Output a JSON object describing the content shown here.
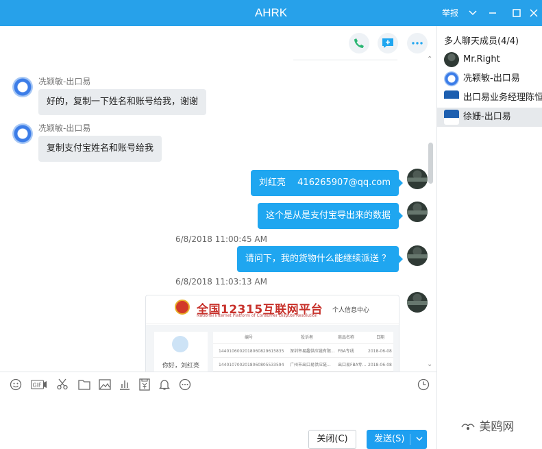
{
  "window": {
    "title": "AHRK",
    "report_label": "举报"
  },
  "chat": {
    "messages_left": [
      {
        "sender": "冼颖敏-出口易",
        "text": "好的，复制一下姓名和账号给我，谢谢"
      },
      {
        "sender": "冼颖敏-出口易",
        "text": "复制支付宝姓名和账号给我"
      }
    ],
    "messages_right": [
      {
        "text": "刘红亮　 416265907@qq.com"
      },
      {
        "text": "这个是从是支付宝导出来的数据"
      },
      {
        "text": "请问下，我的货物什么能继续派送 ？"
      }
    ],
    "timestamps": [
      "6/8/2018 11:00:45 AM",
      "6/8/2018 11:03:13 AM"
    ],
    "image_message": {
      "headline": "全国12315互联网平台",
      "subline": "National Internet Platform of Consumer Dispute Resolution",
      "center_link": "个人信息中心",
      "greeting": "你好，刘红亮",
      "columns": [
        "编号",
        "投诉者",
        "商品名称",
        "日期"
      ],
      "rows": [
        [
          "1440106002018060829615835",
          "深圳市易趣供应链有限...",
          "FBA专线",
          "2018-06-08"
        ],
        [
          "1440107002018060805533594",
          "广州市出口易供应链...",
          "出口易FBA专...",
          "2018-06-08"
        ]
      ]
    }
  },
  "buttons": {
    "close": "关闭(C)",
    "send": "发送(S)"
  },
  "members": {
    "header": "多人聊天成员(4/4)",
    "list": [
      {
        "name": "Mr.Right",
        "avatar": "photo",
        "selected": false
      },
      {
        "name": "冼颖敏-出口易",
        "avatar": "blue",
        "selected": false
      },
      {
        "name": "出口易业务经理陈恒",
        "avatar": "logo",
        "selected": false
      },
      {
        "name": "徐姗-出口易",
        "avatar": "logo",
        "selected": true
      }
    ]
  },
  "watermark": "美鸥网",
  "colors": {
    "titlebar": "#27a1ea",
    "bubble_right": "#1fa6f0",
    "bubble_left": "#e9ecef",
    "send_button": "#1e9ff0"
  }
}
